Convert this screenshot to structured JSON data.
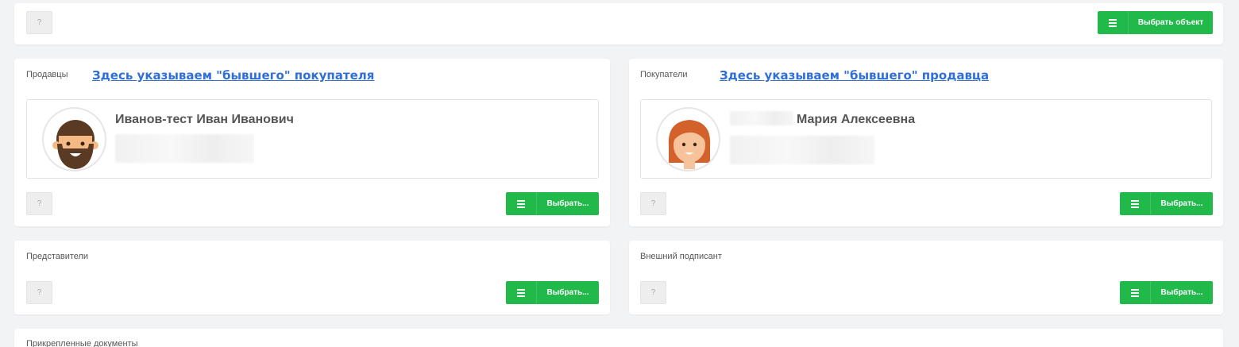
{
  "top_panel": {
    "help_label": "?",
    "select_object_label": "Выбрать объект"
  },
  "sellers": {
    "label": "Продавцы",
    "hint": "Здесь указываем \"бывшего\" покупателя",
    "person_name": "Иванов-тест Иван Иванович",
    "help_label": "?",
    "select_label": "Выбрать..."
  },
  "buyers": {
    "label": "Покупатели",
    "hint": "Здесь указываем \"бывшего\" продавца",
    "person_name": "Мария Алексеевна",
    "help_label": "?",
    "select_label": "Выбрать..."
  },
  "representatives": {
    "label": "Представители",
    "help_label": "?",
    "select_label": "Выбрать..."
  },
  "external_signer": {
    "label": "Внешний подписант",
    "help_label": "?",
    "select_label": "Выбрать..."
  },
  "attachments": {
    "label": "Прикрепленные документы"
  },
  "colors": {
    "accent_green": "#22b94b",
    "hint_blue": "#2f6fd6",
    "background": "#f2f3f5"
  }
}
